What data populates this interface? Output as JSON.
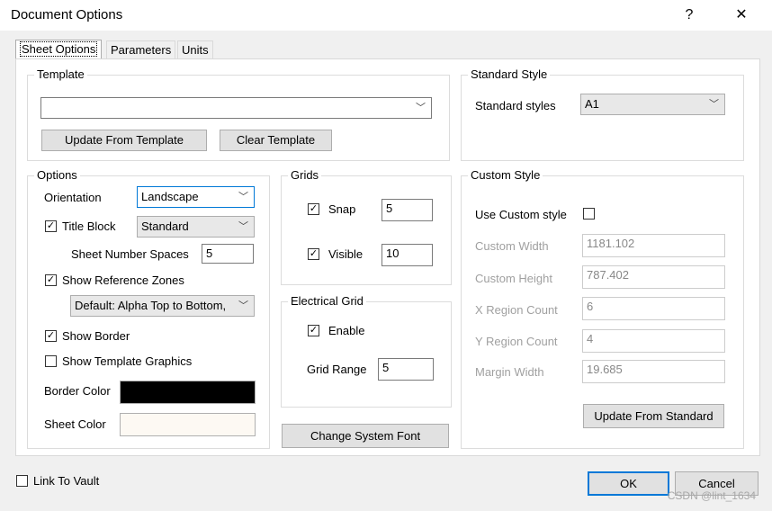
{
  "window": {
    "title": "Document Options",
    "help_glyph": "?",
    "close_glyph": "✕"
  },
  "tabs": [
    {
      "label": "Sheet Options"
    },
    {
      "label": "Parameters"
    },
    {
      "label": "Units"
    }
  ],
  "template": {
    "group_label": "Template",
    "combo_value": "",
    "update_button": "Update From Template",
    "clear_button": "Clear Template"
  },
  "standard_style": {
    "group_label": "Standard Style",
    "label": "Standard styles",
    "value": "A1"
  },
  "options": {
    "group_label": "Options",
    "orientation_label": "Orientation",
    "orientation_value": "Landscape",
    "title_block_label": "Title Block",
    "title_block_checked": "✓",
    "title_block_value": "Standard",
    "sheet_number_spaces_label": "Sheet Number Spaces",
    "sheet_number_spaces_value": "5",
    "show_reference_zones_label": "Show Reference Zones",
    "show_reference_zones_checked": "✓",
    "reference_zone_style": "Default: Alpha Top to Bottom,",
    "show_border_label": "Show Border",
    "show_border_checked": "✓",
    "show_template_graphics_label": "Show Template Graphics",
    "show_template_graphics_checked": "",
    "border_color_label": "Border Color",
    "sheet_color_label": "Sheet Color"
  },
  "grids": {
    "group_label": "Grids",
    "snap_label": "Snap",
    "snap_checked": "✓",
    "snap_value": "5",
    "visible_label": "Visible",
    "visible_checked": "✓",
    "visible_value": "10"
  },
  "electrical_grid": {
    "group_label": "Electrical Grid",
    "enable_label": "Enable",
    "enable_checked": "✓",
    "grid_range_label": "Grid Range",
    "grid_range_value": "5"
  },
  "change_font_button": "Change System Font",
  "custom_style": {
    "group_label": "Custom Style",
    "use_custom_label": "Use Custom style",
    "use_custom_checked": "",
    "custom_width_label": "Custom Width",
    "custom_width_value": "1181.102",
    "custom_height_label": "Custom Height",
    "custom_height_value": "787.402",
    "x_region_label": "X Region Count",
    "x_region_value": "6",
    "y_region_label": "Y Region Count",
    "y_region_value": "4",
    "margin_width_label": "Margin Width",
    "margin_width_value": "19.685",
    "update_button": "Update From Standard"
  },
  "footer": {
    "link_to_vault_label": "Link To Vault",
    "link_to_vault_checked": "",
    "ok_button": "OK",
    "cancel_button": "Cancel"
  },
  "watermark": "CSDN @lint_1634",
  "colors": {
    "border_color": "#000000",
    "sheet_color": "#fdf9f3",
    "accent": "#0078d7"
  }
}
